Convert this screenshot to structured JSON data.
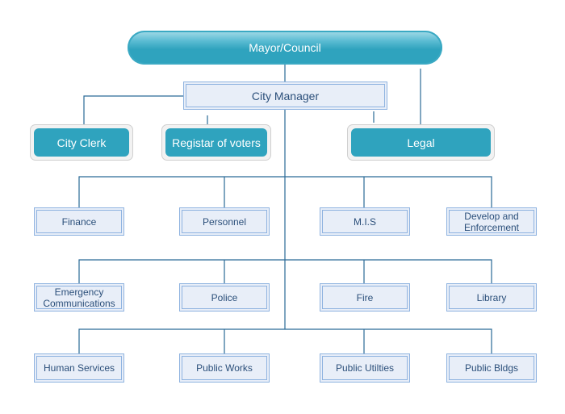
{
  "top": {
    "label": "Mayor/Council"
  },
  "manager": {
    "label": "City Manager"
  },
  "staff": [
    {
      "label": "City Clerk"
    },
    {
      "label": "Registar of voters"
    },
    {
      "label": "Legal"
    }
  ],
  "departments": [
    [
      {
        "label": "Finance"
      },
      {
        "label": "Personnel"
      },
      {
        "label": "M.I.S"
      },
      {
        "label": "Develop and Enforcement"
      }
    ],
    [
      {
        "label": "Emergency Communications"
      },
      {
        "label": "Police"
      },
      {
        "label": "Fire"
      },
      {
        "label": "Library"
      }
    ],
    [
      {
        "label": "Human Services"
      },
      {
        "label": "Public Works"
      },
      {
        "label": "Public Utilties"
      },
      {
        "label": "Public Bldgs"
      }
    ]
  ],
  "colors": {
    "node_fill": "#2fa3be",
    "box_fill": "#e8eef8",
    "box_border": "#8fb3e0",
    "connector": "#2a6a96"
  }
}
